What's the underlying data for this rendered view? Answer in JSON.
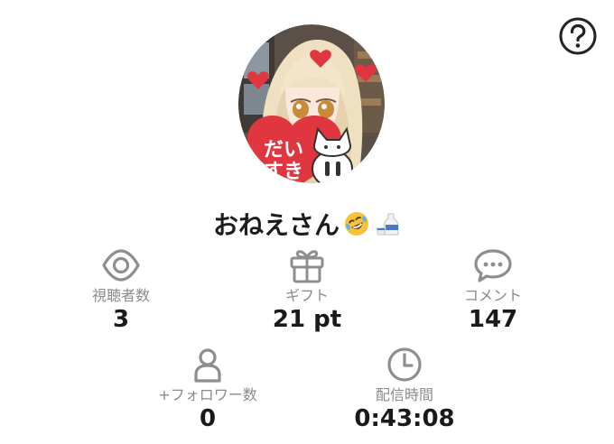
{
  "profile": {
    "username": "おねえさん",
    "emojis": [
      "rolling-on-floor-laughing-emoji",
      "sake-emoji"
    ],
    "avatar_text": "だいすき"
  },
  "stats": {
    "viewers": {
      "label": "視聴者数",
      "value": "3",
      "icon": "eye-icon"
    },
    "gifts": {
      "label": "ギフト",
      "value": "21 pt",
      "icon": "gift-icon"
    },
    "comments": {
      "label": "コメント",
      "value": "147",
      "icon": "chat-bubble-icon"
    },
    "followers": {
      "label": "+フォロワー数",
      "value": "0",
      "icon": "person-icon"
    },
    "duration": {
      "label": "配信時間",
      "value": "0:43:08",
      "icon": "clock-icon"
    }
  },
  "colors": {
    "icon_gray": "#8e8e8e",
    "label_gray": "#8a8a8a",
    "heart_red": "#e0363f"
  }
}
